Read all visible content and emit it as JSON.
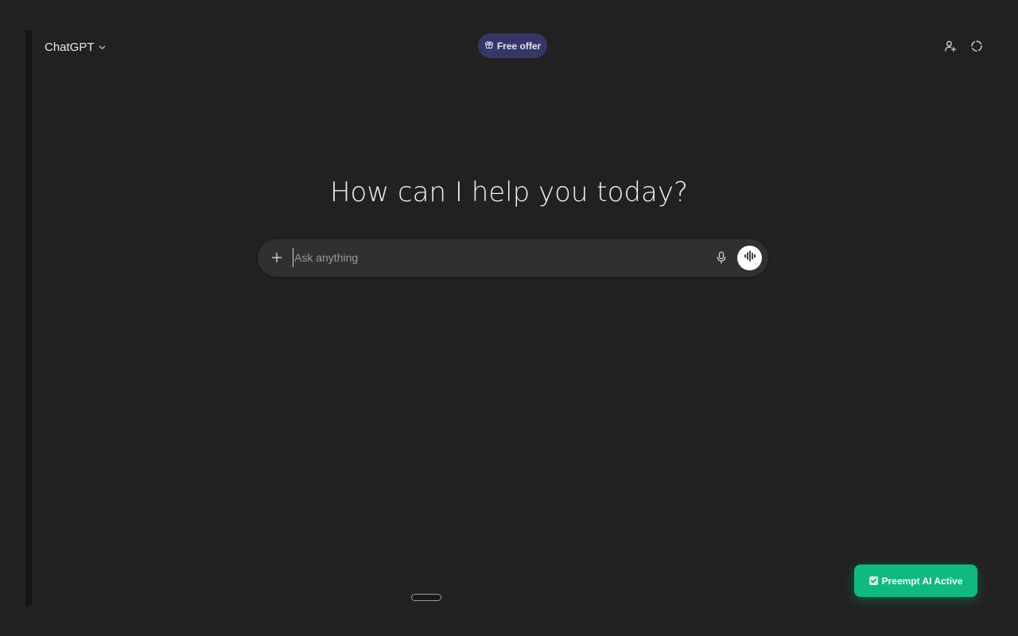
{
  "header": {
    "model_label": "ChatGPT",
    "offer_label": "Free offer",
    "icons": {
      "model_chevron": "chevron-down-icon",
      "offer": "gift-icon",
      "add_people": "add-user-icon",
      "temporary_chat": "dashed-circle-icon"
    }
  },
  "main": {
    "headline": "How can I help you today?"
  },
  "composer": {
    "placeholder": "Ask anything",
    "value": "",
    "icons": {
      "attach": "plus-icon",
      "dictate": "microphone-icon",
      "voice_mode": "waveform-icon"
    }
  },
  "extension": {
    "badge_label": "Preempt AI Active",
    "badge_icon": "checkbox-icon"
  },
  "colors": {
    "background": "#212121",
    "offer_pill": "#373669",
    "composer": "#303030",
    "badge": "#10b981"
  }
}
